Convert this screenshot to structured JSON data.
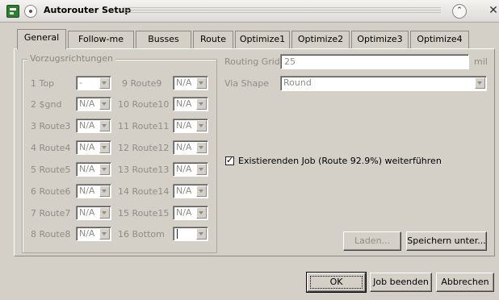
{
  "window": {
    "title": "Autorouter Setup"
  },
  "tabs": [
    {
      "label": "General",
      "active": true
    },
    {
      "label": "Follow-me"
    },
    {
      "label": "Busses"
    },
    {
      "label": "Route"
    },
    {
      "label": "Optimize1"
    },
    {
      "label": "Optimize2"
    },
    {
      "label": "Optimize3"
    },
    {
      "label": "Optimize4"
    }
  ],
  "preferences": {
    "group_title": "Vorzugsrichtungen",
    "left_layers": [
      {
        "label": "1 Top",
        "value": "-"
      },
      {
        "label": "2 $gnd",
        "value": "N/A"
      },
      {
        "label": "3 Route3",
        "value": "N/A"
      },
      {
        "label": "4 Route4",
        "value": "N/A"
      },
      {
        "label": "5 Route5",
        "value": "N/A"
      },
      {
        "label": "6 Route6",
        "value": "N/A"
      },
      {
        "label": "7 Route7",
        "value": "N/A"
      },
      {
        "label": "8 Route8",
        "value": "N/A"
      }
    ],
    "right_layers": [
      {
        "label": "9 Route9",
        "value": "N/A"
      },
      {
        "label": "10 Route10",
        "value": "N/A"
      },
      {
        "label": "11 Route11",
        "value": "N/A"
      },
      {
        "label": "12 Route12",
        "value": "N/A"
      },
      {
        "label": "13 Route13",
        "value": "N/A"
      },
      {
        "label": "14 Route14",
        "value": "N/A"
      },
      {
        "label": "15 Route15",
        "value": "N/A"
      },
      {
        "label": "16 Bottom",
        "value": ""
      }
    ]
  },
  "routing": {
    "grid_label": "Routing Grid",
    "grid_value": "25",
    "grid_unit": "mil",
    "via_label": "Via Shape",
    "via_value": "Round"
  },
  "continue_job": {
    "label": "Existierenden Job (Route 92.9%) weiterführen",
    "checked": true
  },
  "buttons": {
    "load": "Laden...",
    "save_as": "Speichern unter...",
    "ok": "OK",
    "end_job": "Job beenden",
    "cancel": "Abbrechen"
  }
}
